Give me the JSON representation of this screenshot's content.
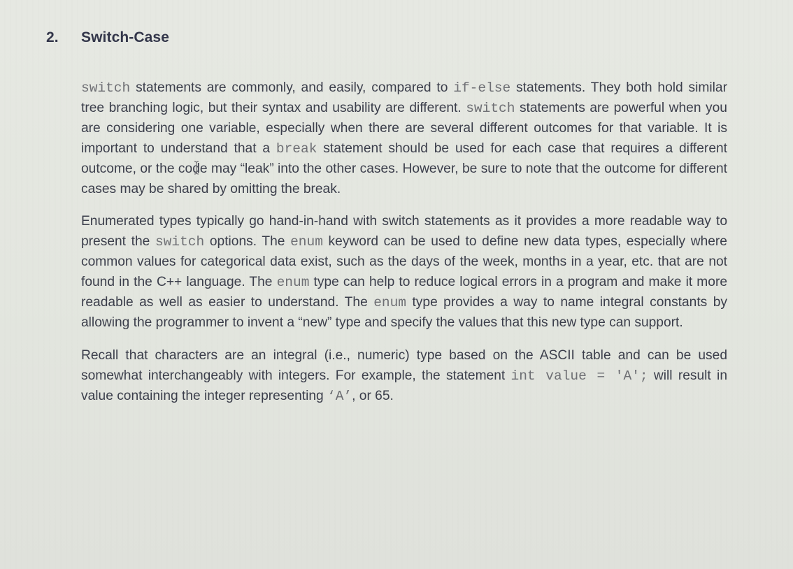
{
  "section": {
    "number": "2.",
    "title": "Switch-Case"
  },
  "paragraphs": [
    {
      "segments": [
        {
          "text": "switch",
          "code": true
        },
        {
          "text": " statements are commonly, and easily, compared to ",
          "code": false
        },
        {
          "text": "if-else",
          "code": true
        },
        {
          "text": " statements. They both hold similar tree branching logic, but their syntax and usability are different. ",
          "code": false
        },
        {
          "text": "switch",
          "code": true
        },
        {
          "text": " statements are powerful when you are considering one variable, especially when there are several different outcomes for that variable. It is important to understand that a ",
          "code": false
        },
        {
          "text": "break",
          "code": true
        },
        {
          "text": " statement should be used for each case that requires a different outcome, or the code may “leak” into the other cases. However, be sure to note that the outcome for different cases may be shared by omitting the break.",
          "code": false
        }
      ]
    },
    {
      "segments": [
        {
          "text": "Enumerated types typically go hand-in-hand with switch statements as it provides a more readable way to present the ",
          "code": false
        },
        {
          "text": "switch",
          "code": true
        },
        {
          "text": " options. The ",
          "code": false
        },
        {
          "text": "enum",
          "code": true
        },
        {
          "text": " keyword can be used to define new data types, especially where common values for categorical data exist, such as the days of the week, months in a year, etc. that are not found in the C++ language. The ",
          "code": false
        },
        {
          "text": "enum",
          "code": true
        },
        {
          "text": " type can help to reduce logical errors in a program and make it more readable as well as easier to understand. The ",
          "code": false
        },
        {
          "text": "enum",
          "code": true
        },
        {
          "text": " type provides a way to name integral constants by allowing the programmer to invent a “new” type and specify the values that this new type can support.",
          "code": false
        }
      ]
    },
    {
      "segments": [
        {
          "text": "Recall that characters are an integral (i.e., numeric) type based on the ASCII table and can be used somewhat interchangeably with integers. For example, the statement ",
          "code": false
        },
        {
          "text": "int value = 'A';",
          "code": true
        },
        {
          "text": " will result in value containing the integer representing ",
          "code": false
        },
        {
          "text": "‘A’",
          "code": true
        },
        {
          "text": ", or 65.",
          "code": false
        }
      ]
    }
  ],
  "cursor": {
    "icon": "text-cursor-ibeam-icon"
  }
}
